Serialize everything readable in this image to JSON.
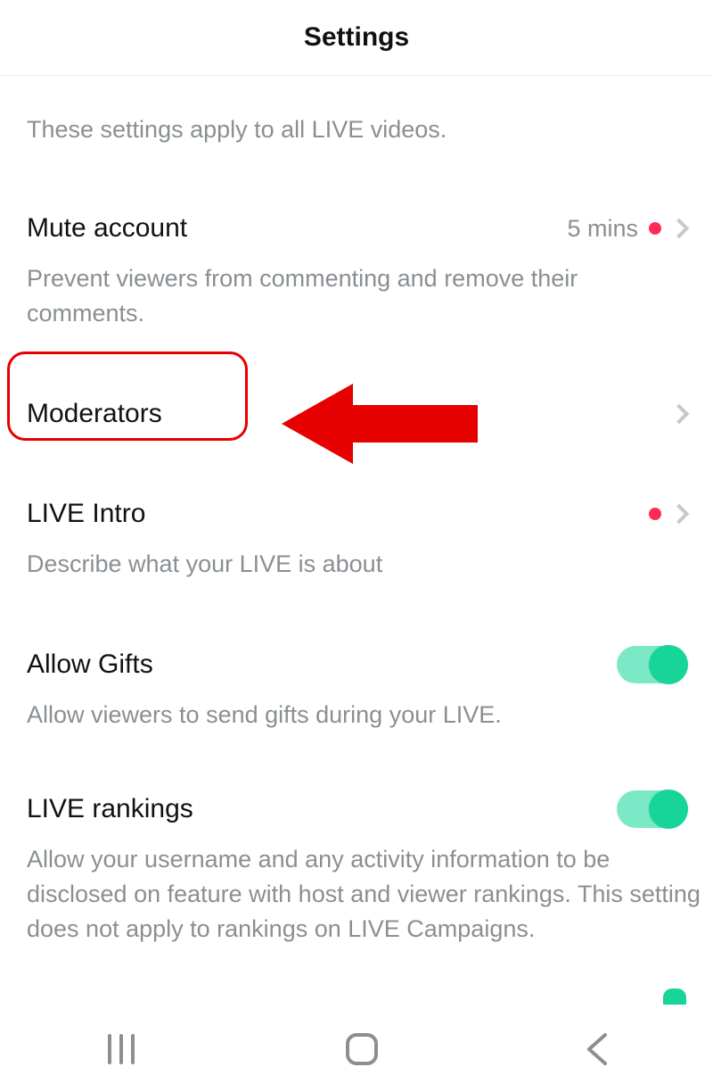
{
  "header": {
    "title": "Settings"
  },
  "intro": "These settings apply to all LIVE videos.",
  "rows": {
    "mute": {
      "title": "Mute account",
      "value": "5 mins",
      "desc": "Prevent viewers from commenting and remove their comments."
    },
    "moderators": {
      "title": "Moderators"
    },
    "liveIntro": {
      "title": "LIVE Intro",
      "desc": "Describe what your LIVE is about"
    },
    "allowGifts": {
      "title": "Allow Gifts",
      "desc": "Allow viewers to send gifts during your LIVE."
    },
    "liveRankings": {
      "title": "LIVE rankings",
      "desc": "Allow your username and any activity information to be disclosed on feature with host and viewer rankings. This setting does not apply to rankings on LIVE Campaigns."
    }
  }
}
